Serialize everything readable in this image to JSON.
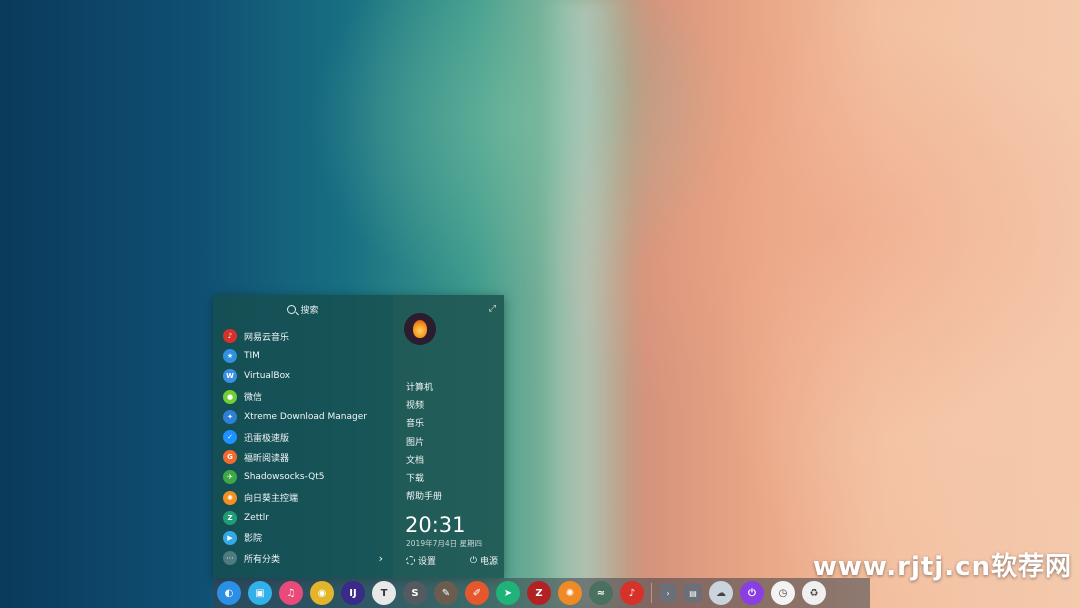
{
  "watermark": "www.rjtj.cn软荐网",
  "launcher": {
    "search_label": "搜索",
    "apps": [
      {
        "label": "网易云音乐",
        "icon": "netease-music-icon",
        "color": "#d7322a",
        "glyph": "♪"
      },
      {
        "label": "TIM",
        "icon": "tim-icon",
        "color": "#2f8fe0",
        "glyph": "★"
      },
      {
        "label": "VirtualBox",
        "icon": "virtualbox-icon",
        "color": "#3a8ee6",
        "glyph": "W"
      },
      {
        "label": "微信",
        "icon": "wechat-icon",
        "color": "#6fcf35",
        "glyph": "●"
      },
      {
        "label": "Xtreme Download Manager",
        "icon": "xdm-icon",
        "color": "#2e7fd6",
        "glyph": "✦"
      },
      {
        "label": "迅雷极速版",
        "icon": "thunder-icon",
        "color": "#1e90ff",
        "glyph": "✓"
      },
      {
        "label": "福昕阅读器",
        "icon": "foxit-icon",
        "color": "#f26a30",
        "glyph": "G"
      },
      {
        "label": "Shadowsocks-Qt5",
        "icon": "shadowsocks-icon",
        "color": "#3da845",
        "glyph": "✈"
      },
      {
        "label": "向日葵主控端",
        "icon": "sunflower-icon",
        "color": "#f39020",
        "glyph": "✺"
      },
      {
        "label": "Zettlr",
        "icon": "zettlr-icon",
        "color": "#1f9e76",
        "glyph": "Z"
      },
      {
        "label": "影院",
        "icon": "movie-icon",
        "color": "#35a9e8",
        "glyph": "▶"
      }
    ],
    "all_categories": "所有分类",
    "places": [
      "计算机",
      "视频",
      "音乐",
      "图片",
      "文档",
      "下载",
      "帮助手册"
    ],
    "clock": "20:31",
    "date": "2019年7月4日 星期四",
    "settings_label": "设置",
    "power_label": "电源"
  },
  "dock": {
    "items": [
      {
        "icon": "deepin-launcher-icon",
        "color": "#2c8fe6",
        "glyph": "◐"
      },
      {
        "icon": "deepin-store-icon",
        "color": "#32b0e8",
        "glyph": "▣"
      },
      {
        "icon": "music-app-icon",
        "color": "#e84a7a",
        "glyph": "♫"
      },
      {
        "icon": "chrome-icon",
        "color": "#e2b52a",
        "glyph": "◉"
      },
      {
        "icon": "intellij-icon",
        "color": "#3a2a8a",
        "glyph": "IJ"
      },
      {
        "icon": "typora-icon",
        "color": "#e8e8e8",
        "glyph": "T"
      },
      {
        "icon": "sublime-icon",
        "color": "#555a60",
        "glyph": "S"
      },
      {
        "icon": "gimp-icon",
        "color": "#6b5c50",
        "glyph": "✎"
      },
      {
        "icon": "draw-icon",
        "color": "#e5572d",
        "glyph": "✐"
      },
      {
        "icon": "send-anywhere-icon",
        "color": "#1fb37a",
        "glyph": "➤"
      },
      {
        "icon": "filezilla-icon",
        "color": "#b22222",
        "glyph": "Z"
      },
      {
        "icon": "sunflower-dock-icon",
        "color": "#f08a24",
        "glyph": "✺"
      },
      {
        "icon": "shadowsocks-dock-icon",
        "color": "#4a7060",
        "glyph": "≈"
      },
      {
        "icon": "netease-music-dock-icon",
        "color": "#d7322a",
        "glyph": "♪"
      }
    ],
    "tray": [
      {
        "icon": "tray-expand-icon",
        "glyph": "›"
      },
      {
        "icon": "tray-keyboard-icon",
        "glyph": "▤"
      }
    ],
    "tray_round": [
      {
        "icon": "weather-icon",
        "color": "#c9d4de",
        "glyph": "☁"
      },
      {
        "icon": "shutdown-icon",
        "color": "#8a3fe0",
        "glyph": "⏻"
      },
      {
        "icon": "clock-icon",
        "color": "#f3f3f3",
        "glyph": "◷"
      },
      {
        "icon": "trash-icon",
        "color": "#f0f0f0",
        "glyph": "♻"
      }
    ]
  }
}
